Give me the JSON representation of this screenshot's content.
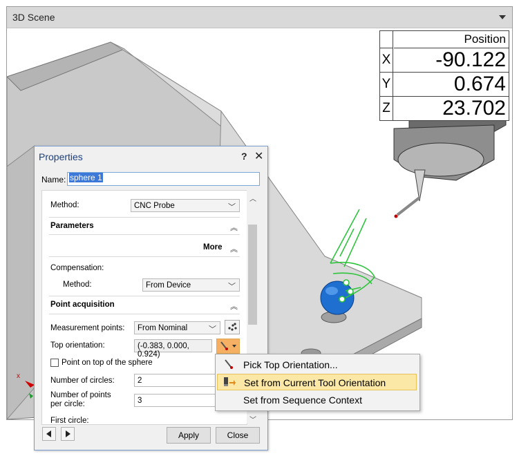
{
  "scene": {
    "title": "3D Scene",
    "position": {
      "header": "Position",
      "rows": [
        {
          "axis": "X",
          "value": "-90.122"
        },
        {
          "axis": "Y",
          "value": "0.674"
        },
        {
          "axis": "Z",
          "value": "23.702"
        }
      ]
    },
    "axis_indicator": {
      "x_label": "x"
    }
  },
  "properties": {
    "title": "Properties",
    "help_label": "?",
    "close_label": "✕",
    "name_label": "Name:",
    "name_value": "sphere 1",
    "method_label": "Method:",
    "method_value": "CNC Probe",
    "parameters_label": "Parameters",
    "more_label": "More",
    "compensation_label": "Compensation:",
    "comp_method_label": "Method:",
    "comp_method_value": "From Device",
    "point_acq_label": "Point acquisition",
    "meas_points_label": "Measurement points:",
    "meas_points_value": "From Nominal",
    "top_orient_label": "Top orientation:",
    "top_orient_value": "(-0.383, 0.000, 0.924)",
    "point_on_top_label": "Point on top of the sphere",
    "point_on_top_checked": false,
    "num_circles_label": "Number of circles:",
    "num_circles_value": "2",
    "num_points_label_1": "Number of points",
    "num_points_label_2": "per circle:",
    "num_points_value": "3",
    "first_circle_label": "First circle:",
    "apply_label": "Apply",
    "close_button_label": "Close"
  },
  "menu": {
    "items": [
      {
        "label": "Pick Top Orientation...",
        "icon": "probe-pick-icon",
        "highlighted": false
      },
      {
        "label": "Set from Current Tool Orientation",
        "icon": "tool-orientation-icon",
        "highlighted": true
      },
      {
        "label": "Set from Sequence Context",
        "icon": "",
        "highlighted": false
      }
    ]
  },
  "colors": {
    "accent": "#3b78d8",
    "highlight": "#fbe8a6",
    "sphere": "#1e6fd0",
    "path": "#2ec43c"
  }
}
